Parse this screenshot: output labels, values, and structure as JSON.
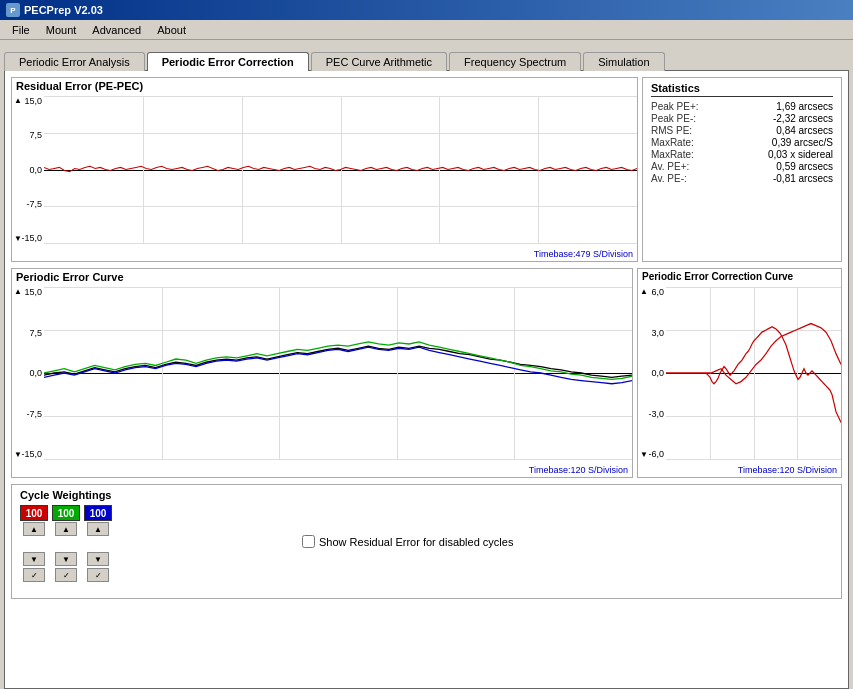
{
  "window": {
    "title": "PECPrep V2.03"
  },
  "menu": {
    "items": [
      {
        "label": "File",
        "id": "file"
      },
      {
        "label": "Mount",
        "id": "mount"
      },
      {
        "label": "Advanced",
        "id": "advanced"
      },
      {
        "label": "About",
        "id": "about"
      }
    ]
  },
  "tabs": [
    {
      "label": "Periodic Error Analysis",
      "id": "pea",
      "active": false
    },
    {
      "label": "Periodic Error Correction",
      "id": "pec",
      "active": true
    },
    {
      "label": "PEC Curve Arithmetic",
      "id": "pca",
      "active": false
    },
    {
      "label": "Frequency Spectrum",
      "id": "fs",
      "active": false
    },
    {
      "label": "Simulation",
      "id": "sim",
      "active": false
    }
  ],
  "residual_chart": {
    "title": "Residual Error (PE-PEC)",
    "y_labels": [
      "15,0",
      "7,5",
      "0,0",
      "-7,5",
      "-15,0"
    ],
    "timebase": "Timebase:479 S/Division"
  },
  "statistics": {
    "title": "Statistics",
    "rows": [
      {
        "label": "Peak PE+:",
        "value": "1,69 arcsecs"
      },
      {
        "label": "Peak PE-:",
        "value": "-2,32 arcsecs"
      },
      {
        "label": "RMS PE:",
        "value": "0,84 arcsecs"
      },
      {
        "label": "MaxRate:",
        "value": "0,39 arcsec/S"
      },
      {
        "label": "MaxRate:",
        "value2": "0,03 x sidereal"
      },
      {
        "label": "Av. PE+:",
        "value": "0,59 arcsecs"
      },
      {
        "label": "Av. PE-:",
        "value": "-0,81 arcsecs"
      }
    ]
  },
  "pe_curve": {
    "title": "Periodic Error Curve",
    "y_labels": [
      "15,0",
      "7,5",
      "0,0",
      "-7,5",
      "-15,0"
    ],
    "timebase": "Timebase:120 S/Division"
  },
  "pec_curve": {
    "title": "Periodic Error Correction Curve",
    "y_labels": [
      "6,0",
      "3,0",
      "0,0",
      "-3,0",
      "-6,0"
    ],
    "timebase": "Timebase:120 S/Division"
  },
  "cycle_weightings": {
    "title": "Cycle Weightings",
    "cycles": [
      {
        "color": "red",
        "value": "100"
      },
      {
        "color": "green",
        "value": "100"
      },
      {
        "color": "blue",
        "value": "100"
      }
    ],
    "show_residual_label": "Show Residual Error for disabled cycles"
  }
}
